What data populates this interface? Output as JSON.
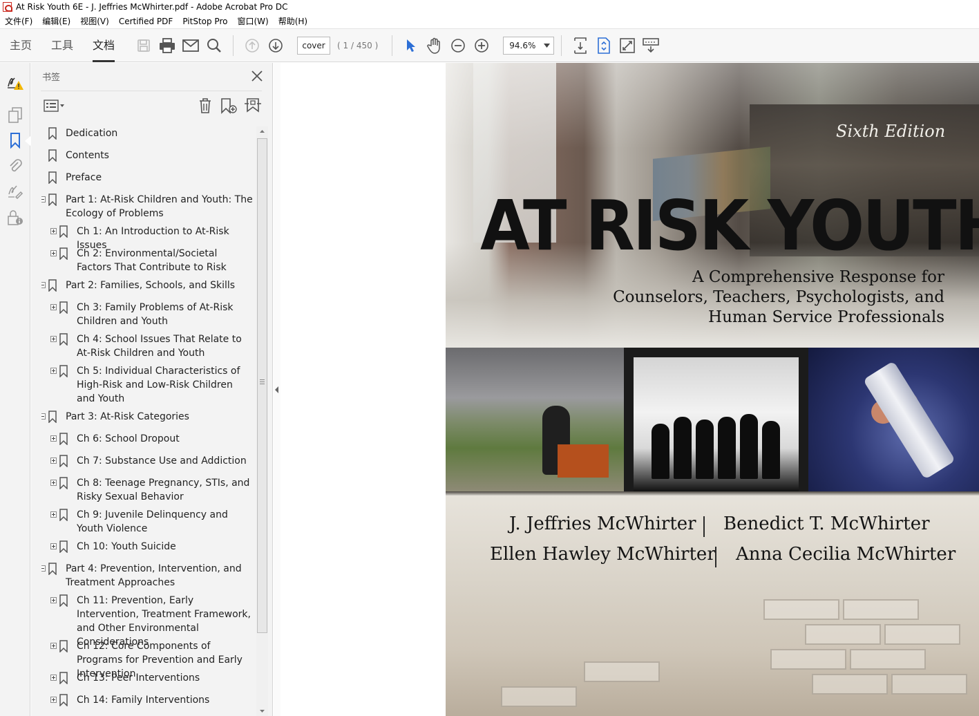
{
  "window": {
    "title": "At Risk Youth 6E - J. Jeffries McWhirter.pdf - Adobe Acrobat Pro DC"
  },
  "menu": [
    "文件(F)",
    "编辑(E)",
    "视图(V)",
    "Certified PDF",
    "PitStop Pro",
    "窗口(W)",
    "帮助(H)"
  ],
  "toolbar": {
    "tabs": [
      "主页",
      "工具",
      "文档"
    ],
    "active_tab": "文档",
    "page_input": "cover",
    "page_count": "( 1 / 450 )",
    "zoom": "94.6%"
  },
  "panel": {
    "title": "书签",
    "bookmarks": [
      {
        "label": "Dedication",
        "level": 0,
        "expander": "none"
      },
      {
        "label": "Contents",
        "level": 0,
        "expander": "none"
      },
      {
        "label": "Preface",
        "level": 0,
        "expander": "none"
      },
      {
        "label": "Part 1: At-Risk Children and Youth: The Ecology of Problems",
        "level": 0,
        "expander": "minus"
      },
      {
        "label": "Ch 1: An Introduction to At-Risk Issues",
        "level": 1,
        "expander": "plus"
      },
      {
        "label": "Ch 2: Environmental/Societal Factors That Contribute to Risk",
        "level": 1,
        "expander": "plus"
      },
      {
        "label": "Part 2: Families, Schools, and Skills",
        "level": 0,
        "expander": "minus"
      },
      {
        "label": "Ch 3: Family Problems of At-Risk Children and Youth",
        "level": 1,
        "expander": "plus"
      },
      {
        "label": "Ch 4: School Issues That Relate to At-Risk Children and Youth",
        "level": 1,
        "expander": "plus"
      },
      {
        "label": "Ch 5: Individual Characteristics of High-Risk and Low-Risk Children and Youth",
        "level": 1,
        "expander": "plus"
      },
      {
        "label": "Part 3: At-Risk Categories",
        "level": 0,
        "expander": "minus"
      },
      {
        "label": "Ch 6: School Dropout",
        "level": 1,
        "expander": "plus"
      },
      {
        "label": "Ch 7: Substance Use and Addiction",
        "level": 1,
        "expander": "plus"
      },
      {
        "label": "Ch 8: Teenage Pregnancy, STIs, and Risky Sexual Behavior",
        "level": 1,
        "expander": "plus"
      },
      {
        "label": "Ch 9: Juvenile Delinquency and Youth Violence",
        "level": 1,
        "expander": "plus"
      },
      {
        "label": "Ch 10: Youth Suicide",
        "level": 1,
        "expander": "plus"
      },
      {
        "label": "Part 4: Prevention, Intervention, and Treatment Approaches",
        "level": 0,
        "expander": "minus"
      },
      {
        "label": "Ch 11: Prevention, Early Intervention, Treatment Framework, and Other Environmental Considerations",
        "level": 1,
        "expander": "plus"
      },
      {
        "label": "Ch 12: Core Components of Programs for Prevention and Early Intervention",
        "level": 1,
        "expander": "plus"
      },
      {
        "label": "Ch 13: Peer Interventions",
        "level": 1,
        "expander": "plus"
      },
      {
        "label": "Ch 14: Family Interventions",
        "level": 1,
        "expander": "plus"
      }
    ]
  },
  "cover": {
    "edition": "Sixth Edition",
    "title": "AT RISK YOUTH",
    "subtitle_lines": [
      "A Comprehensive Response for",
      "Counselors, Teachers, Psychologists, and",
      "Human Service Professionals"
    ],
    "authors": [
      "J. Jeffries McWhirter",
      "Benedict T. McWhirter",
      "Ellen Hawley McWhirter",
      "Anna Cecilia McWhirter"
    ]
  },
  "colors": {
    "accent": "#2d6fd6",
    "warning": "#f2b705",
    "toolbar_bg": "#f7f7f7",
    "panel_bg": "#f3f3f3"
  }
}
